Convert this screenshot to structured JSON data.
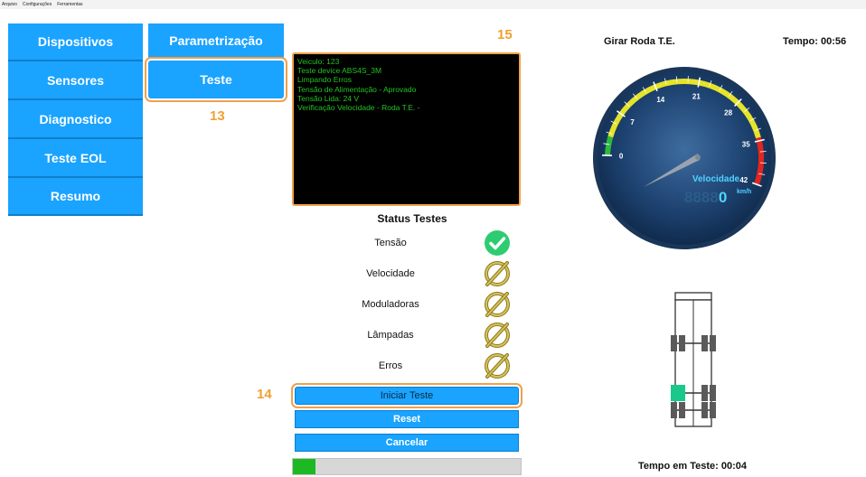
{
  "menu": [
    "Arquivo",
    "Configurações",
    "Ferramentas"
  ],
  "nav": [
    "Dispositivos",
    "Sensores",
    "Diagnostico",
    "Teste EOL",
    "Resumo"
  ],
  "subnav": [
    "Parametrização",
    "Teste"
  ],
  "callouts": {
    "c13": "13",
    "c14": "14",
    "c15": "15"
  },
  "console_lines": [
    "Veiculo: 123",
    "Teste device ABS4S_3M",
    "Limpando Erros",
    "Tensão de Alimentação - Aprovado",
    "Tensão Lida: 24 V",
    "Verificação Velocidade - Roda T.E. -"
  ],
  "status": {
    "title": "Status Testes",
    "items": [
      {
        "label": "Tensão",
        "state": "ok"
      },
      {
        "label": "Velocidade",
        "state": "pending"
      },
      {
        "label": "Moduladoras",
        "state": "pending"
      },
      {
        "label": "Lâmpadas",
        "state": "pending"
      },
      {
        "label": "Erros",
        "state": "pending"
      }
    ]
  },
  "actions": {
    "start": "Iniciar Teste",
    "reset": "Reset",
    "cancel": "Cancelar"
  },
  "progress": 0.1,
  "gauge": {
    "header": "Girar Roda T.E.",
    "timer": "Tempo: 00:56",
    "label": "Velocidade",
    "readout_ghost": "8888",
    "readout_value": "0",
    "unit": "km/h",
    "ticks": [
      "0",
      "7",
      "14",
      "21",
      "28",
      "35",
      "42"
    ],
    "min": 0,
    "max": 42,
    "value": 0
  },
  "test_time": "Tempo em Teste: 00:04",
  "colors": {
    "accent": "#1aa3ff",
    "highlight": "#f0a14a",
    "console_text": "#22c322",
    "ok": "#2ecc71",
    "active_wheel": "#19c88a"
  }
}
